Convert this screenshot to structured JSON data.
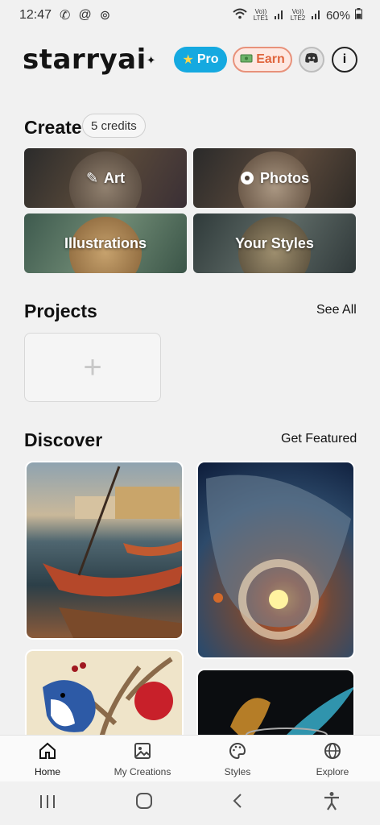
{
  "status": {
    "time": "12:47",
    "battery": "60%",
    "sim1": "Vo)) LTE1",
    "sim2": "Vo)) LTE2"
  },
  "header": {
    "logo": "starryai",
    "pro_label": "Pro",
    "earn_label": "Earn",
    "info_label": "i"
  },
  "create": {
    "title": "Create",
    "credits": "5 credits",
    "tiles": [
      {
        "label": "Art"
      },
      {
        "label": "Photos"
      },
      {
        "label": "Illustrations"
      },
      {
        "label": "Your Styles"
      }
    ]
  },
  "projects": {
    "title": "Projects",
    "see_all": "See All",
    "add_symbol": "+"
  },
  "discover": {
    "title": "Discover",
    "get_featured": "Get Featured"
  },
  "nav": {
    "items": [
      {
        "label": "Home"
      },
      {
        "label": "My Creations"
      },
      {
        "label": "Styles"
      },
      {
        "label": "Explore"
      }
    ]
  },
  "colors": {
    "pro": "#15a9e0",
    "earn": "#e0653d",
    "background": "#f1f1f1"
  }
}
